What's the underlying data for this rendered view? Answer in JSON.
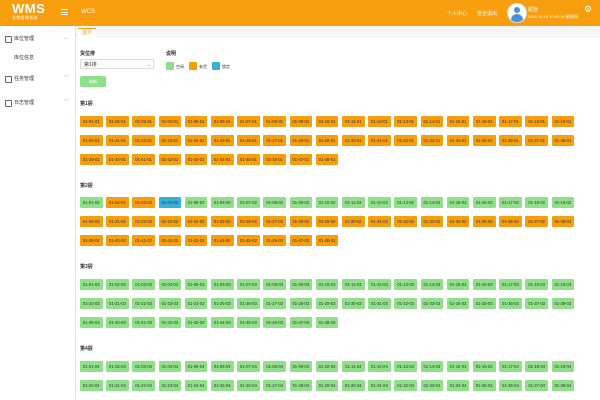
{
  "header": {
    "logo_text": "WMS",
    "logo_subtext": "仓储管理系统",
    "app_title": "WCS",
    "links": [
      "个人中心",
      "安全退出"
    ],
    "user_name": "超管",
    "user_time": "2025.10.16 10:00:19 星期四"
  },
  "sidebar": {
    "groups": [
      {
        "label": "库位管理"
      },
      {
        "label": "任务管理"
      },
      {
        "label": "日志管理"
      }
    ],
    "sub_item": "库位信息"
  },
  "tabs": [
    "首页"
  ],
  "filter": {
    "label": "货位排",
    "value": "第1排",
    "button": "刷新"
  },
  "legend": {
    "title": "说明",
    "items": [
      {
        "label": "空闲",
        "color": "#90e08a"
      },
      {
        "label": "有货",
        "color": "#f79e0f"
      },
      {
        "label": "锁定",
        "color": "#3ab0d6"
      }
    ]
  },
  "layers": [
    {
      "title": "第1层",
      "cells": [
        {
          "label": "01-01-01",
          "state": "stock"
        },
        {
          "label": "01-02-01",
          "state": "stock"
        },
        {
          "label": "01-03-01",
          "state": "stock"
        },
        {
          "label": "01-04-01",
          "state": "stock"
        },
        {
          "label": "01-05-01",
          "state": "stock"
        },
        {
          "label": "01-06-01",
          "state": "stock"
        },
        {
          "label": "01-07-01",
          "state": "stock"
        },
        {
          "label": "01-08-01",
          "state": "stock"
        },
        {
          "label": "01-09-01",
          "state": "stock"
        },
        {
          "label": "01-10-01",
          "state": "stock"
        },
        {
          "label": "01-11-01",
          "state": "stock"
        },
        {
          "label": "01-12-01",
          "state": "stock"
        },
        {
          "label": "01-13-01",
          "state": "stock"
        },
        {
          "label": "01-14-01",
          "state": "stock"
        },
        {
          "label": "01-15-01",
          "state": "stock"
        },
        {
          "label": "01-16-01",
          "state": "stock"
        },
        {
          "label": "01-17-01",
          "state": "stock"
        },
        {
          "label": "01-18-01",
          "state": "stock"
        },
        {
          "label": "01-19-01",
          "state": "stock"
        },
        {
          "label": "01-20-01",
          "state": "stock"
        },
        {
          "label": "01-21-01",
          "state": "stock"
        },
        {
          "label": "01-22-01",
          "state": "stock"
        },
        {
          "label": "01-23-01",
          "state": "stock"
        },
        {
          "label": "01-24-01",
          "state": "stock"
        },
        {
          "label": "01-25-01",
          "state": "stock"
        },
        {
          "label": "01-26-01",
          "state": "stock"
        },
        {
          "label": "01-27-01",
          "state": "stock"
        },
        {
          "label": "01-28-01",
          "state": "stock"
        },
        {
          "label": "01-29-01",
          "state": "stock"
        },
        {
          "label": "01-30-01",
          "state": "stock"
        },
        {
          "label": "01-31-01",
          "state": "stock"
        },
        {
          "label": "01-32-01",
          "state": "stock"
        },
        {
          "label": "01-33-01",
          "state": "stock"
        },
        {
          "label": "01-34-01",
          "state": "stock"
        },
        {
          "label": "01-35-01",
          "state": "stock"
        },
        {
          "label": "01-36-01",
          "state": "stock"
        },
        {
          "label": "01-37-01",
          "state": "stock"
        },
        {
          "label": "01-38-01",
          "state": "stock"
        },
        {
          "label": "01-39-01",
          "state": "stock"
        },
        {
          "label": "01-40-01",
          "state": "stock"
        },
        {
          "label": "01-41-01",
          "state": "stock"
        },
        {
          "label": "01-42-01",
          "state": "stock"
        },
        {
          "label": "01-43-01",
          "state": "stock"
        },
        {
          "label": "01-44-01",
          "state": "stock"
        },
        {
          "label": "01-45-01",
          "state": "stock"
        },
        {
          "label": "01-46-01",
          "state": "stock"
        },
        {
          "label": "01-47-01",
          "state": "stock"
        },
        {
          "label": "01-48-01",
          "state": "stock"
        }
      ]
    },
    {
      "title": "第2层",
      "cells": [
        {
          "label": "01-01-02",
          "state": "free"
        },
        {
          "label": "01-02-02",
          "state": "stock"
        },
        {
          "label": "01-03-02",
          "state": "stock"
        },
        {
          "label": "01-04-02",
          "state": "lock"
        },
        {
          "label": "01-05-02",
          "state": "free"
        },
        {
          "label": "01-06-02",
          "state": "free"
        },
        {
          "label": "01-07-02",
          "state": "free"
        },
        {
          "label": "01-08-02",
          "state": "free"
        },
        {
          "label": "01-09-02",
          "state": "free"
        },
        {
          "label": "01-10-02",
          "state": "free"
        },
        {
          "label": "01-11-02",
          "state": "free"
        },
        {
          "label": "01-12-02",
          "state": "free"
        },
        {
          "label": "01-13-02",
          "state": "free"
        },
        {
          "label": "01-14-02",
          "state": "free"
        },
        {
          "label": "01-15-02",
          "state": "free"
        },
        {
          "label": "01-16-02",
          "state": "free"
        },
        {
          "label": "01-17-02",
          "state": "free"
        },
        {
          "label": "01-18-02",
          "state": "free"
        },
        {
          "label": "01-19-02",
          "state": "free"
        },
        {
          "label": "01-20-02",
          "state": "stock"
        },
        {
          "label": "01-21-02",
          "state": "stock"
        },
        {
          "label": "01-22-02",
          "state": "stock"
        },
        {
          "label": "01-23-02",
          "state": "stock"
        },
        {
          "label": "01-24-02",
          "state": "stock"
        },
        {
          "label": "01-25-02",
          "state": "stock"
        },
        {
          "label": "01-26-02",
          "state": "stock"
        },
        {
          "label": "01-27-02",
          "state": "stock"
        },
        {
          "label": "01-28-02",
          "state": "stock"
        },
        {
          "label": "01-29-02",
          "state": "stock"
        },
        {
          "label": "01-30-02",
          "state": "stock"
        },
        {
          "label": "01-31-02",
          "state": "stock"
        },
        {
          "label": "01-32-02",
          "state": "stock"
        },
        {
          "label": "01-33-02",
          "state": "stock"
        },
        {
          "label": "01-34-02",
          "state": "stock"
        },
        {
          "label": "01-35-02",
          "state": "stock"
        },
        {
          "label": "01-36-02",
          "state": "stock"
        },
        {
          "label": "01-37-02",
          "state": "stock"
        },
        {
          "label": "01-38-02",
          "state": "stock"
        },
        {
          "label": "01-39-02",
          "state": "stock"
        },
        {
          "label": "01-40-02",
          "state": "stock"
        },
        {
          "label": "01-41-02",
          "state": "stock"
        },
        {
          "label": "01-42-02",
          "state": "stock"
        },
        {
          "label": "01-43-02",
          "state": "stock"
        },
        {
          "label": "01-44-02",
          "state": "stock"
        },
        {
          "label": "01-45-02",
          "state": "stock"
        },
        {
          "label": "01-46-02",
          "state": "stock"
        },
        {
          "label": "01-47-02",
          "state": "stock"
        },
        {
          "label": "01-48-02",
          "state": "stock"
        }
      ]
    },
    {
      "title": "第3层",
      "cells": [
        {
          "label": "01-01-03",
          "state": "free"
        },
        {
          "label": "01-02-03",
          "state": "free"
        },
        {
          "label": "01-03-03",
          "state": "free"
        },
        {
          "label": "01-04-03",
          "state": "free"
        },
        {
          "label": "01-05-03",
          "state": "free"
        },
        {
          "label": "01-06-03",
          "state": "free"
        },
        {
          "label": "01-07-03",
          "state": "free"
        },
        {
          "label": "01-08-03",
          "state": "free"
        },
        {
          "label": "01-09-03",
          "state": "free"
        },
        {
          "label": "01-10-03",
          "state": "free"
        },
        {
          "label": "01-11-03",
          "state": "free"
        },
        {
          "label": "01-12-03",
          "state": "free"
        },
        {
          "label": "01-13-03",
          "state": "free"
        },
        {
          "label": "01-14-03",
          "state": "free"
        },
        {
          "label": "01-15-03",
          "state": "free"
        },
        {
          "label": "01-16-03",
          "state": "free"
        },
        {
          "label": "01-17-03",
          "state": "free"
        },
        {
          "label": "01-18-03",
          "state": "free"
        },
        {
          "label": "01-19-03",
          "state": "free"
        },
        {
          "label": "01-20-03",
          "state": "free"
        },
        {
          "label": "01-21-03",
          "state": "free"
        },
        {
          "label": "01-22-03",
          "state": "free"
        },
        {
          "label": "01-23-03",
          "state": "free"
        },
        {
          "label": "01-24-03",
          "state": "free"
        },
        {
          "label": "01-25-03",
          "state": "free"
        },
        {
          "label": "01-26-03",
          "state": "free"
        },
        {
          "label": "01-27-03",
          "state": "free"
        },
        {
          "label": "01-28-03",
          "state": "free"
        },
        {
          "label": "01-29-03",
          "state": "free"
        },
        {
          "label": "01-30-03",
          "state": "free"
        },
        {
          "label": "01-31-03",
          "state": "free"
        },
        {
          "label": "01-32-03",
          "state": "free"
        },
        {
          "label": "01-33-03",
          "state": "free"
        },
        {
          "label": "01-34-03",
          "state": "free"
        },
        {
          "label": "01-35-03",
          "state": "free"
        },
        {
          "label": "01-36-03",
          "state": "free"
        },
        {
          "label": "01-37-03",
          "state": "free"
        },
        {
          "label": "01-38-03",
          "state": "free"
        },
        {
          "label": "01-39-03",
          "state": "free"
        },
        {
          "label": "01-40-03",
          "state": "free"
        },
        {
          "label": "01-41-03",
          "state": "free"
        },
        {
          "label": "01-42-03",
          "state": "free"
        },
        {
          "label": "01-43-03",
          "state": "free"
        },
        {
          "label": "01-44-03",
          "state": "free"
        },
        {
          "label": "01-45-03",
          "state": "free"
        },
        {
          "label": "01-46-03",
          "state": "free"
        },
        {
          "label": "01-47-03",
          "state": "free"
        },
        {
          "label": "01-48-03",
          "state": "free"
        }
      ]
    },
    {
      "title": "第4层",
      "cells": [
        {
          "label": "01-01-04",
          "state": "free"
        },
        {
          "label": "01-02-04",
          "state": "free"
        },
        {
          "label": "01-03-04",
          "state": "free"
        },
        {
          "label": "01-04-04",
          "state": "free"
        },
        {
          "label": "01-05-04",
          "state": "free"
        },
        {
          "label": "01-06-04",
          "state": "free"
        },
        {
          "label": "01-07-04",
          "state": "free"
        },
        {
          "label": "01-08-04",
          "state": "free"
        },
        {
          "label": "01-09-04",
          "state": "free"
        },
        {
          "label": "01-10-04",
          "state": "free"
        },
        {
          "label": "01-11-04",
          "state": "free"
        },
        {
          "label": "01-12-04",
          "state": "free"
        },
        {
          "label": "01-13-04",
          "state": "free"
        },
        {
          "label": "01-14-04",
          "state": "free"
        },
        {
          "label": "01-15-04",
          "state": "free"
        },
        {
          "label": "01-16-04",
          "state": "free"
        },
        {
          "label": "01-17-04",
          "state": "free"
        },
        {
          "label": "01-18-04",
          "state": "free"
        },
        {
          "label": "01-19-04",
          "state": "free"
        },
        {
          "label": "01-20-04",
          "state": "free"
        },
        {
          "label": "01-21-04",
          "state": "free"
        },
        {
          "label": "01-22-04",
          "state": "free"
        },
        {
          "label": "01-23-04",
          "state": "free"
        },
        {
          "label": "01-24-04",
          "state": "free"
        },
        {
          "label": "01-25-04",
          "state": "free"
        },
        {
          "label": "01-26-04",
          "state": "free"
        },
        {
          "label": "01-27-04",
          "state": "free"
        },
        {
          "label": "01-28-04",
          "state": "free"
        },
        {
          "label": "01-29-04",
          "state": "free"
        },
        {
          "label": "01-30-04",
          "state": "free"
        },
        {
          "label": "01-31-04",
          "state": "free"
        },
        {
          "label": "01-32-04",
          "state": "free"
        },
        {
          "label": "01-33-04",
          "state": "free"
        },
        {
          "label": "01-34-04",
          "state": "free"
        },
        {
          "label": "01-35-04",
          "state": "free"
        },
        {
          "label": "01-36-04",
          "state": "free"
        },
        {
          "label": "01-37-04",
          "state": "free"
        },
        {
          "label": "01-38-04",
          "state": "free"
        }
      ]
    }
  ]
}
